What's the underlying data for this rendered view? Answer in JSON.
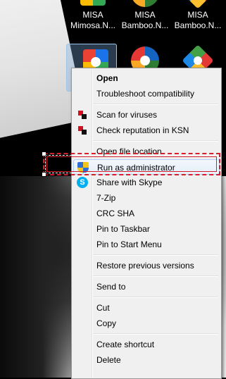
{
  "desktop_icons": [
    {
      "line1": "MISA",
      "line2": "Mimosa.N...",
      "icon": "misa-mimosa-icon"
    },
    {
      "line1": "MISA",
      "line2": "Bamboo.N...",
      "icon": "misa-bamboo-icon"
    },
    {
      "line1": "MISA",
      "line2": "Bamboo.N...",
      "icon": "misa-bamboo-icon"
    }
  ],
  "context_menu": {
    "items": [
      {
        "label": "Open",
        "bold": true
      },
      {
        "label": "Troubleshoot compatibility"
      },
      {
        "label": "Scan for viruses",
        "icon": "kaspersky-icon"
      },
      {
        "label": "Check reputation in KSN",
        "icon": "kaspersky-icon"
      },
      {
        "label": "Open file location"
      },
      {
        "label": "Run as administrator",
        "icon": "uac-shield-icon"
      },
      {
        "label": "Share with Skype",
        "icon": "skype-icon"
      },
      {
        "label": "7-Zip"
      },
      {
        "label": "CRC SHA"
      },
      {
        "label": "Pin to Taskbar"
      },
      {
        "label": "Pin to Start Menu"
      },
      {
        "label": "Restore previous versions"
      },
      {
        "label": "Send to"
      },
      {
        "label": "Cut"
      },
      {
        "label": "Copy"
      },
      {
        "label": "Create shortcut"
      },
      {
        "label": "Delete"
      }
    ],
    "skype_glyph": "S"
  },
  "colors": {
    "highlight_border": "#d4202a",
    "menu_background": "#f0f0f0"
  }
}
